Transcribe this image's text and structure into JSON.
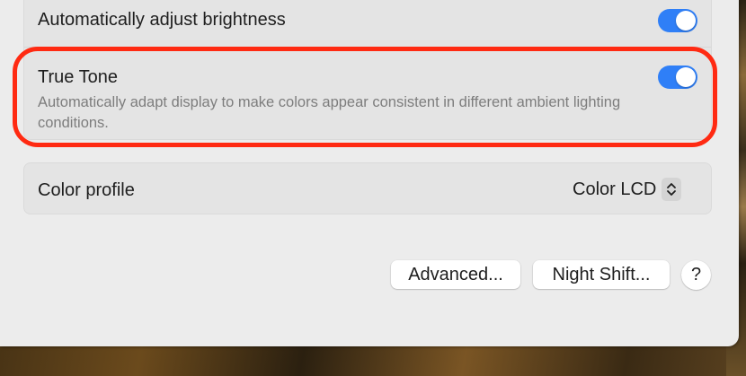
{
  "settings": {
    "brightness": {
      "label": "Automatically adjust brightness",
      "enabled": true
    },
    "true_tone": {
      "label": "True Tone",
      "description": "Automatically adapt display to make colors appear consistent in different ambient lighting conditions.",
      "enabled": true
    },
    "color_profile": {
      "label": "Color profile",
      "value": "Color LCD"
    }
  },
  "buttons": {
    "advanced": "Advanced...",
    "night_shift": "Night Shift...",
    "help": "?"
  },
  "colors": {
    "toggle_on": "#2f7ff7",
    "highlight": "#ff2a12",
    "window_bg": "#ececec",
    "row_bg": "#e4e4e4"
  },
  "icons": {
    "stepper": "chevron-up-down-icon"
  }
}
